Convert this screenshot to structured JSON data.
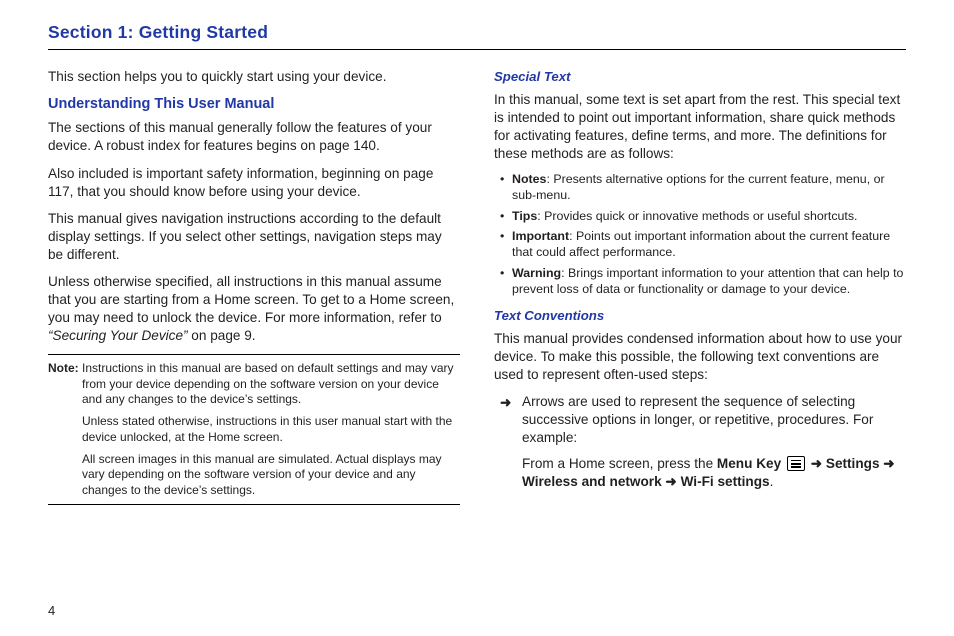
{
  "section_title": "Section 1: Getting Started",
  "page_number": "4",
  "left": {
    "intro": "This section helps you to quickly start using your device.",
    "h2": "Understanding This User Manual",
    "p1": "The sections of this manual generally follow the features of your device. A robust index for features begins on page 140.",
    "p2": "Also included is important safety information, beginning on page 117, that you should know before using your device.",
    "p3": "This manual gives navigation instructions according to the default display settings. If you select other settings, navigation steps may be different.",
    "p4_a": "Unless otherwise specified, all instructions in this manual assume that you are starting from a Home screen. To get to a Home screen, you may need to unlock the device. For more information, refer to ",
    "p4_ref": "“Securing Your Device”",
    "p4_b": "  on page 9.",
    "note_label": "Note:",
    "note1": "Instructions in this manual are based on default settings and may vary from your device depending on the software version on your device and any changes to the device’s settings.",
    "note2": "Unless stated otherwise, instructions in this user manual start with the device unlocked, at the Home screen.",
    "note3": "All screen images in this manual are simulated. Actual displays may vary depending on the software version of your device and any changes to the device’s settings."
  },
  "right": {
    "h3a": "Special Text",
    "p1": "In this manual, some text is set apart from the rest. This special text is intended to point out important information, share quick methods for activating features, define terms, and more. The definitions for these methods are as follows:",
    "bullets": [
      {
        "term": "Notes",
        "desc": ": Presents alternative options for the current feature, menu, or sub-menu."
      },
      {
        "term": "Tips",
        "desc": ": Provides quick or innovative methods or useful shortcuts."
      },
      {
        "term": "Important",
        "desc": ": Points out important information about the current feature that could affect performance."
      },
      {
        "term": "Warning",
        "desc": ": Brings important information to your attention that can help to prevent loss of data or functionality or damage to your device."
      }
    ],
    "h3b": "Text Conventions",
    "p2": "This manual provides condensed information about how to use your device. To make this possible, the following text conventions are used to represent often-used steps:",
    "arrow_glyph": "➜",
    "arrow_item": "Arrows are used to represent the sequence of selecting successive options in longer, or repetitive, procedures. For example:",
    "example_prefix": "From a Home screen, press the ",
    "menu_key": "Menu Key",
    "arrow_small": "➜",
    "settings": "Settings",
    "wireless": "Wireless and network",
    "wifi": "Wi-Fi settings",
    "period": "."
  }
}
